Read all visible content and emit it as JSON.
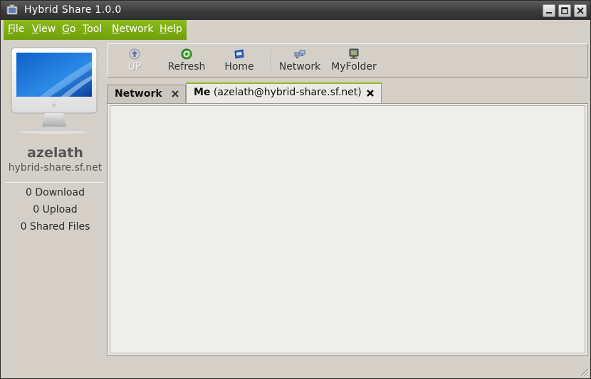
{
  "window": {
    "title": "Hybrid Share 1.0.0"
  },
  "menu": [
    {
      "label": "File",
      "mnemonic": "F",
      "rest": "ile"
    },
    {
      "label": "View",
      "mnemonic": "V",
      "rest": "iew"
    },
    {
      "label": "Go",
      "mnemonic": "G",
      "rest": "o"
    },
    {
      "label": "Tool",
      "mnemonic": "T",
      "rest": "ool"
    },
    {
      "label": "Network",
      "mnemonic": "N",
      "rest": "etwork"
    },
    {
      "label": "Help",
      "mnemonic": "H",
      "rest": "elp"
    }
  ],
  "user": {
    "name": "azelath",
    "host": "hybrid-share.sf.net",
    "downloads": "0 Download",
    "uploads": "0 Upload",
    "shared": "0 Shared Files"
  },
  "toolbar": {
    "up": "UP",
    "refresh": "Refresh",
    "home": "Home",
    "network": "Network",
    "myfolder": "MyFolder"
  },
  "tabs": {
    "network": "Network",
    "me_bold": "Me",
    "me_rest": " (azelath@hybrid-share.sf.net)"
  },
  "colors": {
    "accent": "#7aa812",
    "titlebar": "#3b3b3b"
  },
  "icons": [
    "app-icon",
    "minimize-icon",
    "maximize-icon",
    "close-icon",
    "up-icon",
    "refresh-icon",
    "home-icon",
    "network-icon",
    "folder-icon",
    "monitor-icon",
    "tab-close-icon",
    "resize-grip-icon"
  ]
}
